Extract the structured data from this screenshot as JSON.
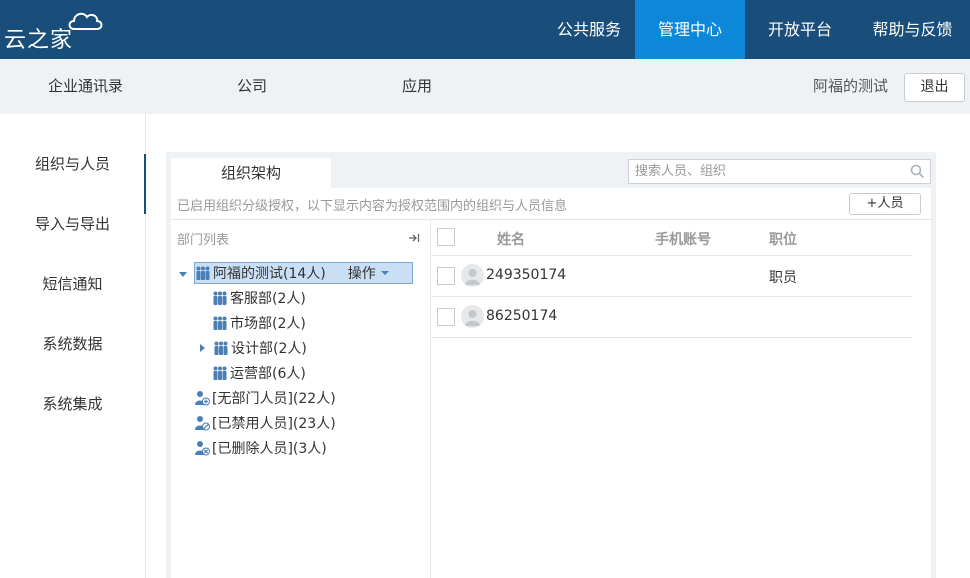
{
  "brand": {
    "logo_text": "云之家"
  },
  "topnav": {
    "items": [
      {
        "label": "公共服务"
      },
      {
        "label": "管理中心"
      },
      {
        "label": "开放平台"
      },
      {
        "label": "帮助与反馈"
      }
    ],
    "active_color": "#0d87d8",
    "bar_color": "#1a4e7a"
  },
  "subnav": {
    "items": [
      {
        "label": "企业通讯录"
      },
      {
        "label": "公司"
      },
      {
        "label": "应用"
      }
    ],
    "user_name": "阿福的测试",
    "logout_label": "退出"
  },
  "sidebar": {
    "items": [
      {
        "label": "组织与人员"
      },
      {
        "label": "导入与导出"
      },
      {
        "label": "短信通知"
      },
      {
        "label": "系统数据"
      },
      {
        "label": "系统集成"
      }
    ]
  },
  "main": {
    "tab_label": "组织架构",
    "search_placeholder": "搜索人员、组织",
    "notice": "已启用组织分级授权，以下显示内容为授权范围内的组织与人员信息",
    "add_person_label": "+人员",
    "dept_list_header": "部门列表",
    "tree": {
      "root": {
        "label": "阿福的测试(14人)",
        "action_label": "操作"
      },
      "children": [
        {
          "label": "客服部(2人)"
        },
        {
          "label": "市场部(2人)"
        },
        {
          "label": "设计部(2人)"
        },
        {
          "label": "运营部(6人)"
        }
      ],
      "special": [
        {
          "label": "[无部门人员](22人)"
        },
        {
          "label": "[已禁用人员](23人)"
        },
        {
          "label": "[已删除人员](3人)"
        }
      ]
    },
    "columns": {
      "name": "姓名",
      "phone": "手机账号",
      "title": "职位"
    },
    "members": [
      {
        "name": "249350174",
        "title": "职员"
      },
      {
        "name": "86250174",
        "title": ""
      }
    ]
  }
}
